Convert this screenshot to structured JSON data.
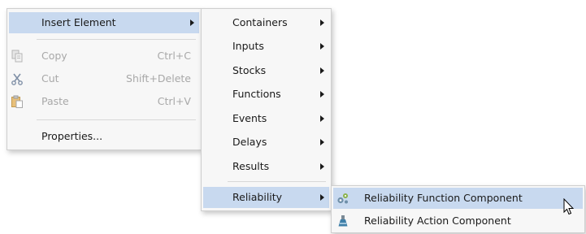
{
  "menu": {
    "insert_element": "Insert Element",
    "copy": {
      "label": "Copy",
      "shortcut": "Ctrl+C",
      "icon": "copy-icon"
    },
    "cut": {
      "label": "Cut",
      "shortcut": "Shift+Delete",
      "icon": "scissors-icon"
    },
    "paste": {
      "label": "Paste",
      "shortcut": "Ctrl+V",
      "icon": "paste-icon"
    },
    "properties": "Properties..."
  },
  "submenu": {
    "containers": "Containers",
    "inputs": "Inputs",
    "stocks": "Stocks",
    "functions": "Functions",
    "events": "Events",
    "delays": "Delays",
    "results": "Results",
    "reliability": "Reliability"
  },
  "reliability_menu": {
    "function_component": {
      "label": "Reliability Function Component",
      "icon": "gears-icon"
    },
    "action_component": {
      "label": "Reliability Action Component",
      "icon": "flask-icon"
    }
  },
  "colors": {
    "highlight": "#c8d9ef",
    "menu_background": "#f7f7f7",
    "disabled_text": "#a8a8a8"
  }
}
